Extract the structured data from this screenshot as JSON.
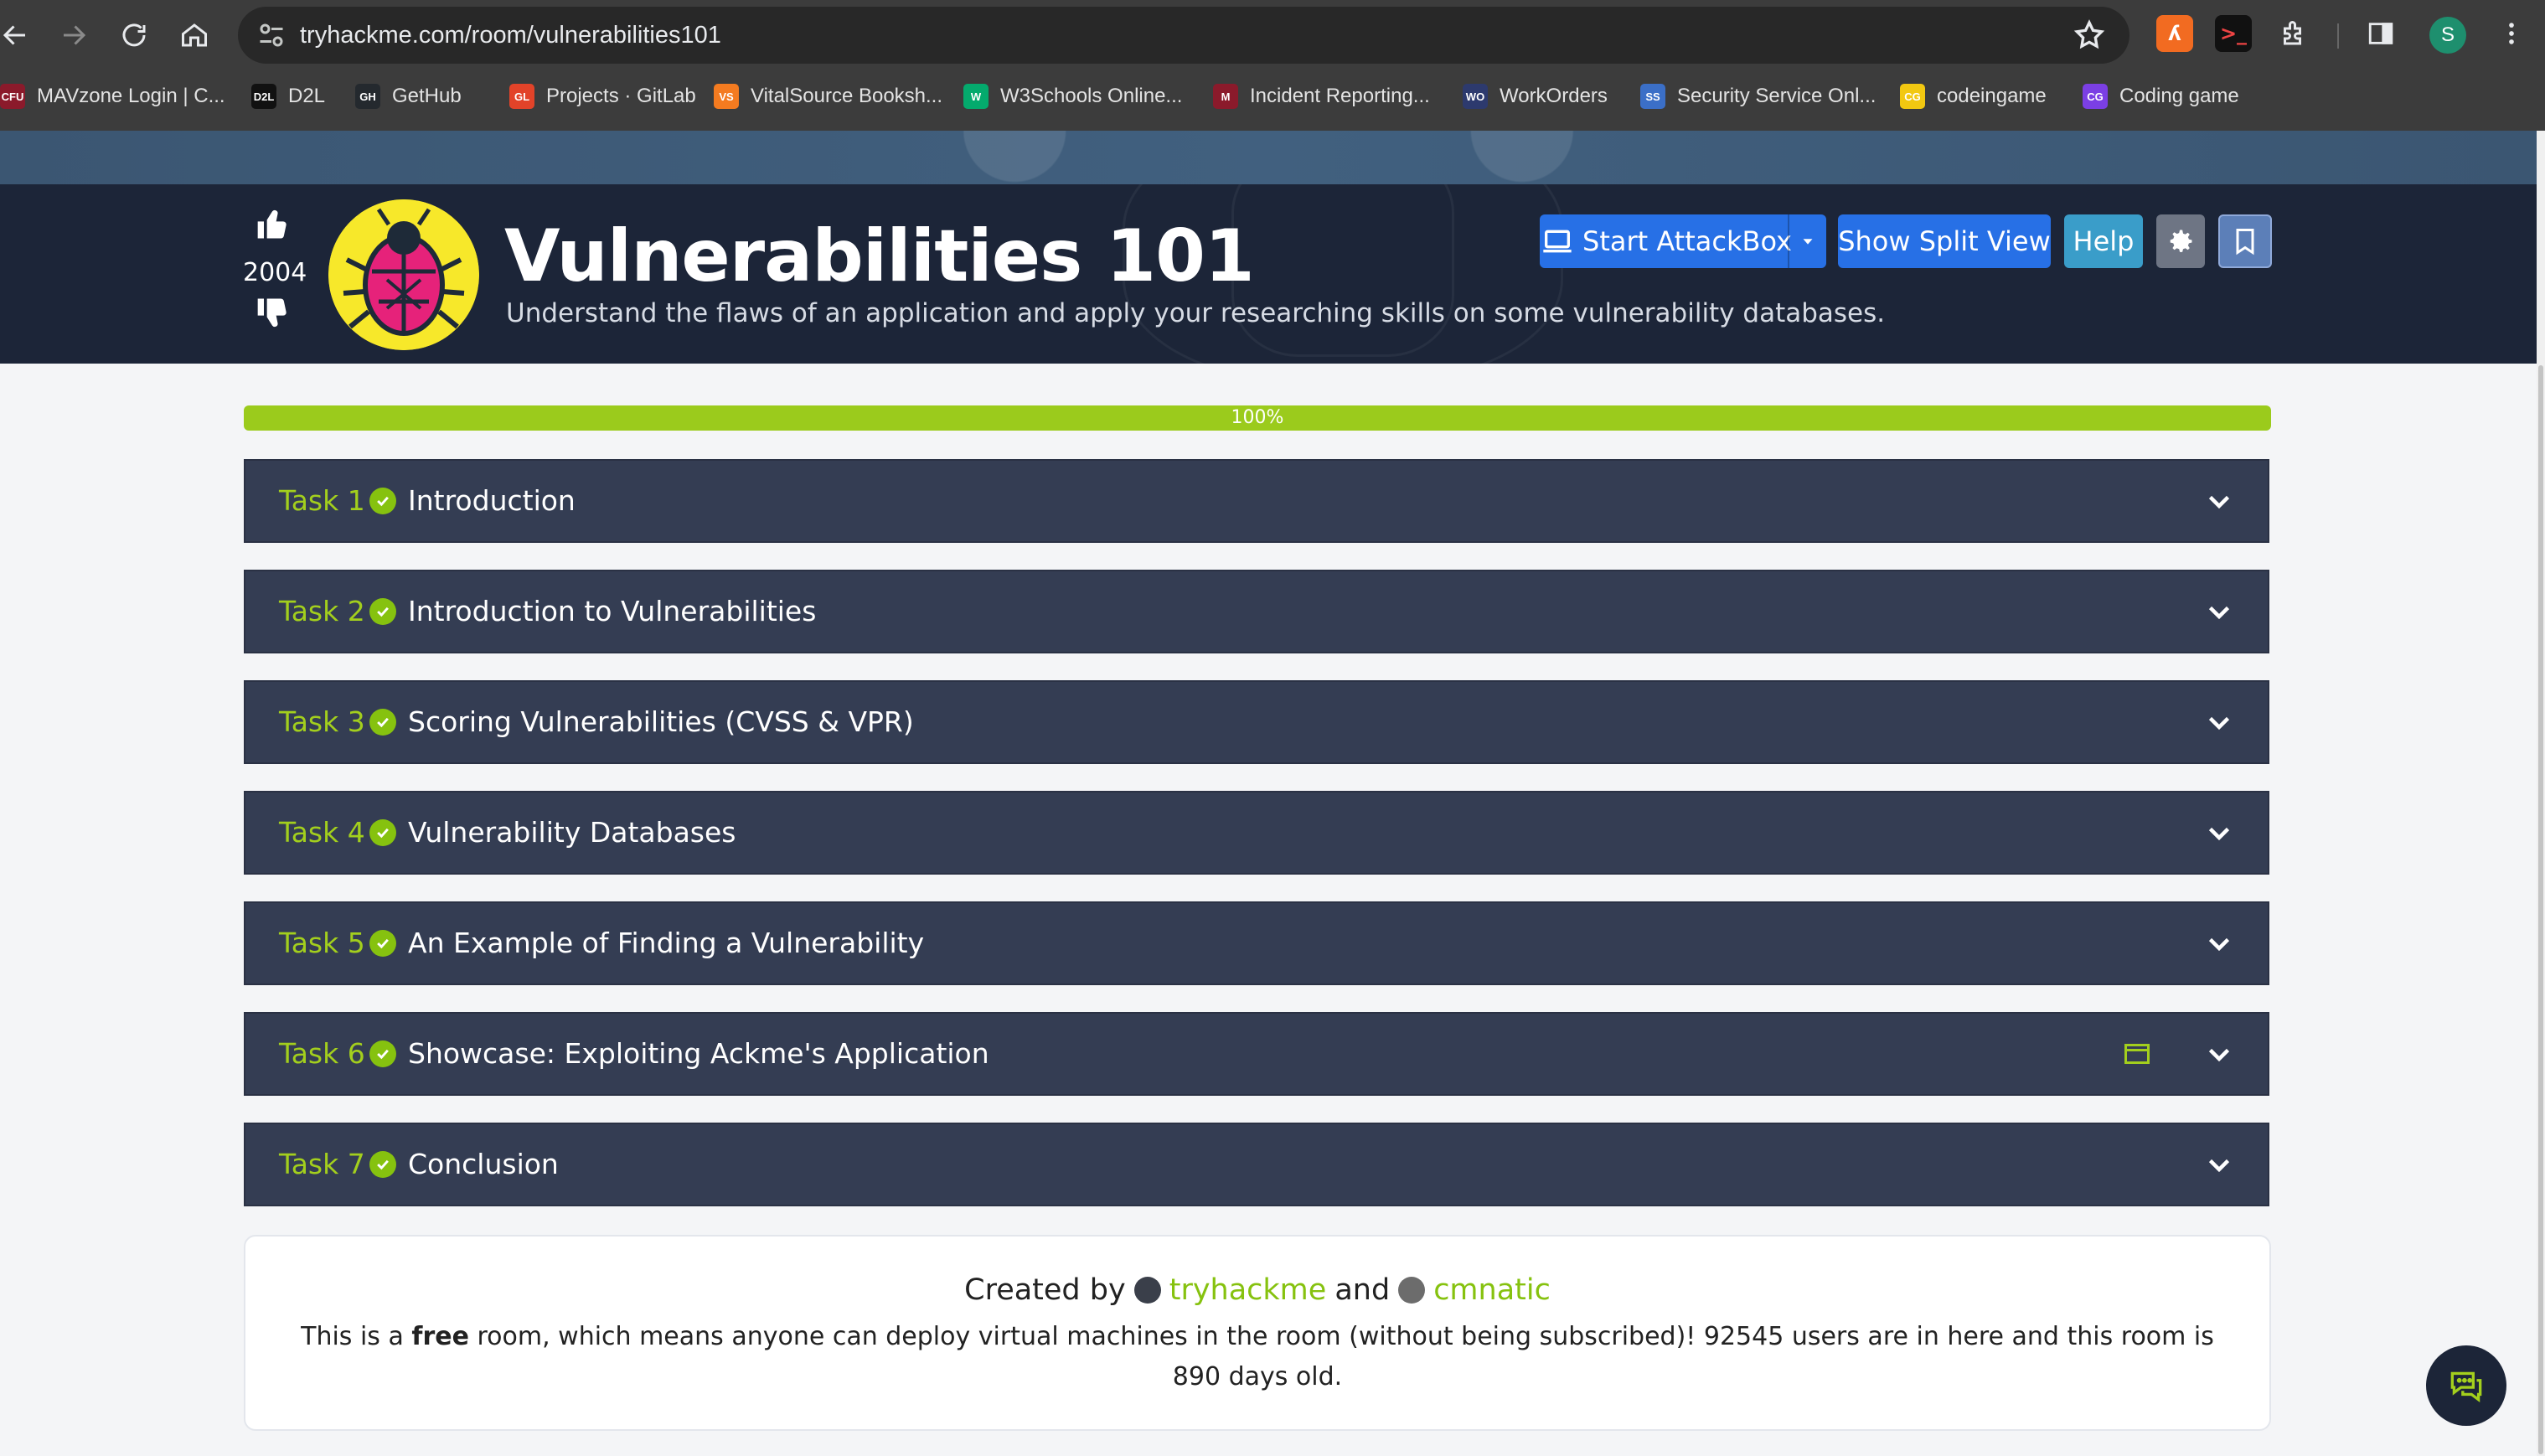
{
  "browser": {
    "url": "tryhackme.com/room/vulnerabilities101",
    "profile_initial": "S",
    "bookmarks": [
      {
        "label": "MAVzone Login | C...",
        "fav": "CFU",
        "color": "#8b1a2b"
      },
      {
        "label": "D2L",
        "fav": "D2L",
        "color": "#111111"
      },
      {
        "label": "GetHub",
        "fav": "GH",
        "color": "#24292e"
      },
      {
        "label": "Projects · GitLab",
        "fav": "GL",
        "color": "#e24329"
      },
      {
        "label": "VitalSource Booksh...",
        "fav": "VS",
        "color": "#f47b20"
      },
      {
        "label": "W3Schools Online...",
        "fav": "W",
        "color": "#04aa6d"
      },
      {
        "label": "Incident Reporting...",
        "fav": "M",
        "color": "#8b1a2b"
      },
      {
        "label": "WorkOrders",
        "fav": "WO",
        "color": "#2d3a6e"
      },
      {
        "label": "Security Service Onl...",
        "fav": "SS",
        "color": "#3b6fc7"
      },
      {
        "label": "codeingame",
        "fav": "CG",
        "color": "#f2c811"
      },
      {
        "label": "Coding game",
        "fav": "CG",
        "color": "#7b3fe4"
      }
    ]
  },
  "room": {
    "upvotes": "2004",
    "title": "Vulnerabilities 101",
    "description": "Understand the flaws of an application and apply your researching skills on some vulnerability databases.",
    "buttons": {
      "attackbox": "Start AttackBox",
      "split_view": "Show Split View",
      "help": "Help"
    },
    "progress": "100%",
    "progress_value": 1.0
  },
  "tasks": [
    {
      "num": "Task 1",
      "title": "Introduction"
    },
    {
      "num": "Task 2",
      "title": "Introduction to Vulnerabilities"
    },
    {
      "num": "Task 3",
      "title": "Scoring Vulnerabilities (CVSS & VPR)"
    },
    {
      "num": "Task 4",
      "title": "Vulnerability Databases"
    },
    {
      "num": "Task 5",
      "title": "An Example of Finding a Vulnerability"
    },
    {
      "num": "Task 6",
      "title": "Showcase: Exploiting Ackme's Application"
    },
    {
      "num": "Task 7",
      "title": "Conclusion"
    }
  ],
  "footer": {
    "created_by": "Created by",
    "author1": "tryhackme",
    "and": "and",
    "author2": "cmnatic",
    "free_prefix": "This is a ",
    "free_word": "free",
    "free_suffix": " room, which means anyone can deploy virtual machines in the room (without being subscribed)! 92545 users are in here and this room is 890 days old."
  },
  "colors": {
    "accent_green": "#a3cf1d",
    "task_bg": "#343d53",
    "hero_bg": "#1c2538",
    "button_blue": "#2770e6"
  }
}
